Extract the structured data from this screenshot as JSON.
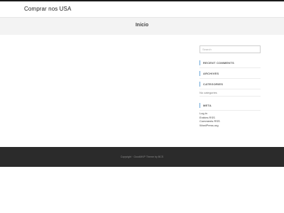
{
  "header": {
    "site_title": "Comprar nos USA"
  },
  "banner": {
    "page_title": "Inicio"
  },
  "sidebar": {
    "search": {
      "placeholder": "Search"
    },
    "widgets": [
      {
        "title": "RECENT COMMENTS"
      },
      {
        "title": "ARCHIVES"
      },
      {
        "title": "CATEGORIES",
        "text": "No categories"
      },
      {
        "title": "META",
        "links": [
          "Log in",
          "Entries RSS",
          "Comments RSS",
          "WordPress.org"
        ]
      }
    ]
  },
  "footer": {
    "text": "Copyright · GoodMVP Theme by BCS"
  },
  "colors": {
    "accent": "#6aa6d8",
    "footer_bg": "#2b2b2b",
    "banner_bg": "#f3f3f3"
  }
}
